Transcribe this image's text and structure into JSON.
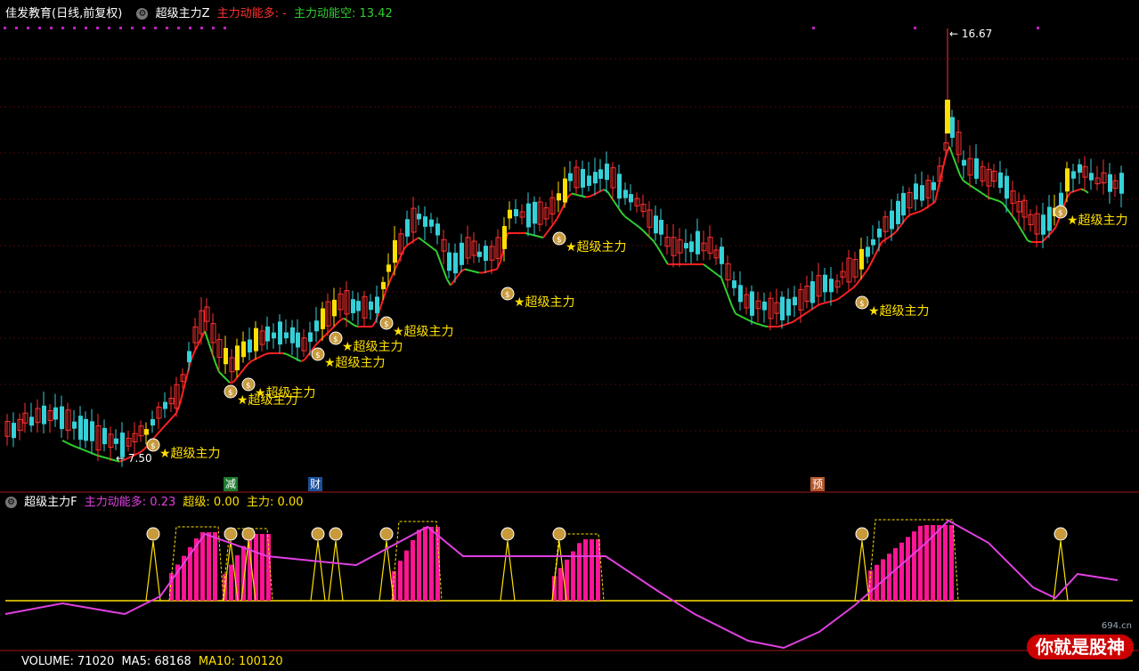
{
  "header": {
    "stock_name": "佳发教育(日线,前复权)",
    "indicator_name": "超级主力Z",
    "long_label": "主力动能多:",
    "long_value": "-",
    "short_label": "主力动能空:",
    "short_value": "13.42"
  },
  "price_labels": {
    "high": "16.67",
    "low": "7.50"
  },
  "signal_label": "★超级主力",
  "event_tags": {
    "jian": "减",
    "cai": "财",
    "yu": "预"
  },
  "sub_header": {
    "indicator_name": "超级主力F",
    "long_label": "主力动能多:",
    "long_value": "0.23",
    "super_label": "超级:",
    "super_value": "0.00",
    "main_label": "主力:",
    "main_value": "0.00"
  },
  "volume_header": {
    "volume_label": "VOLUME:",
    "volume_value": "71020",
    "ma5_label": "MA5:",
    "ma5_value": "68168",
    "ma10_label": "MA10:",
    "ma10_value": "100120"
  },
  "watermark": {
    "text": "你就是股神",
    "url": "694.cn"
  },
  "colors": {
    "up": "#ff3030",
    "down": "#35d0d8",
    "signal_candle": "#ffdf00",
    "trend_up": "#ff2020",
    "trend_down": "#30d030",
    "momentum_line": "#e040e0",
    "momentum_bar": "#ff1493",
    "baseline": "#ffe000"
  }
}
